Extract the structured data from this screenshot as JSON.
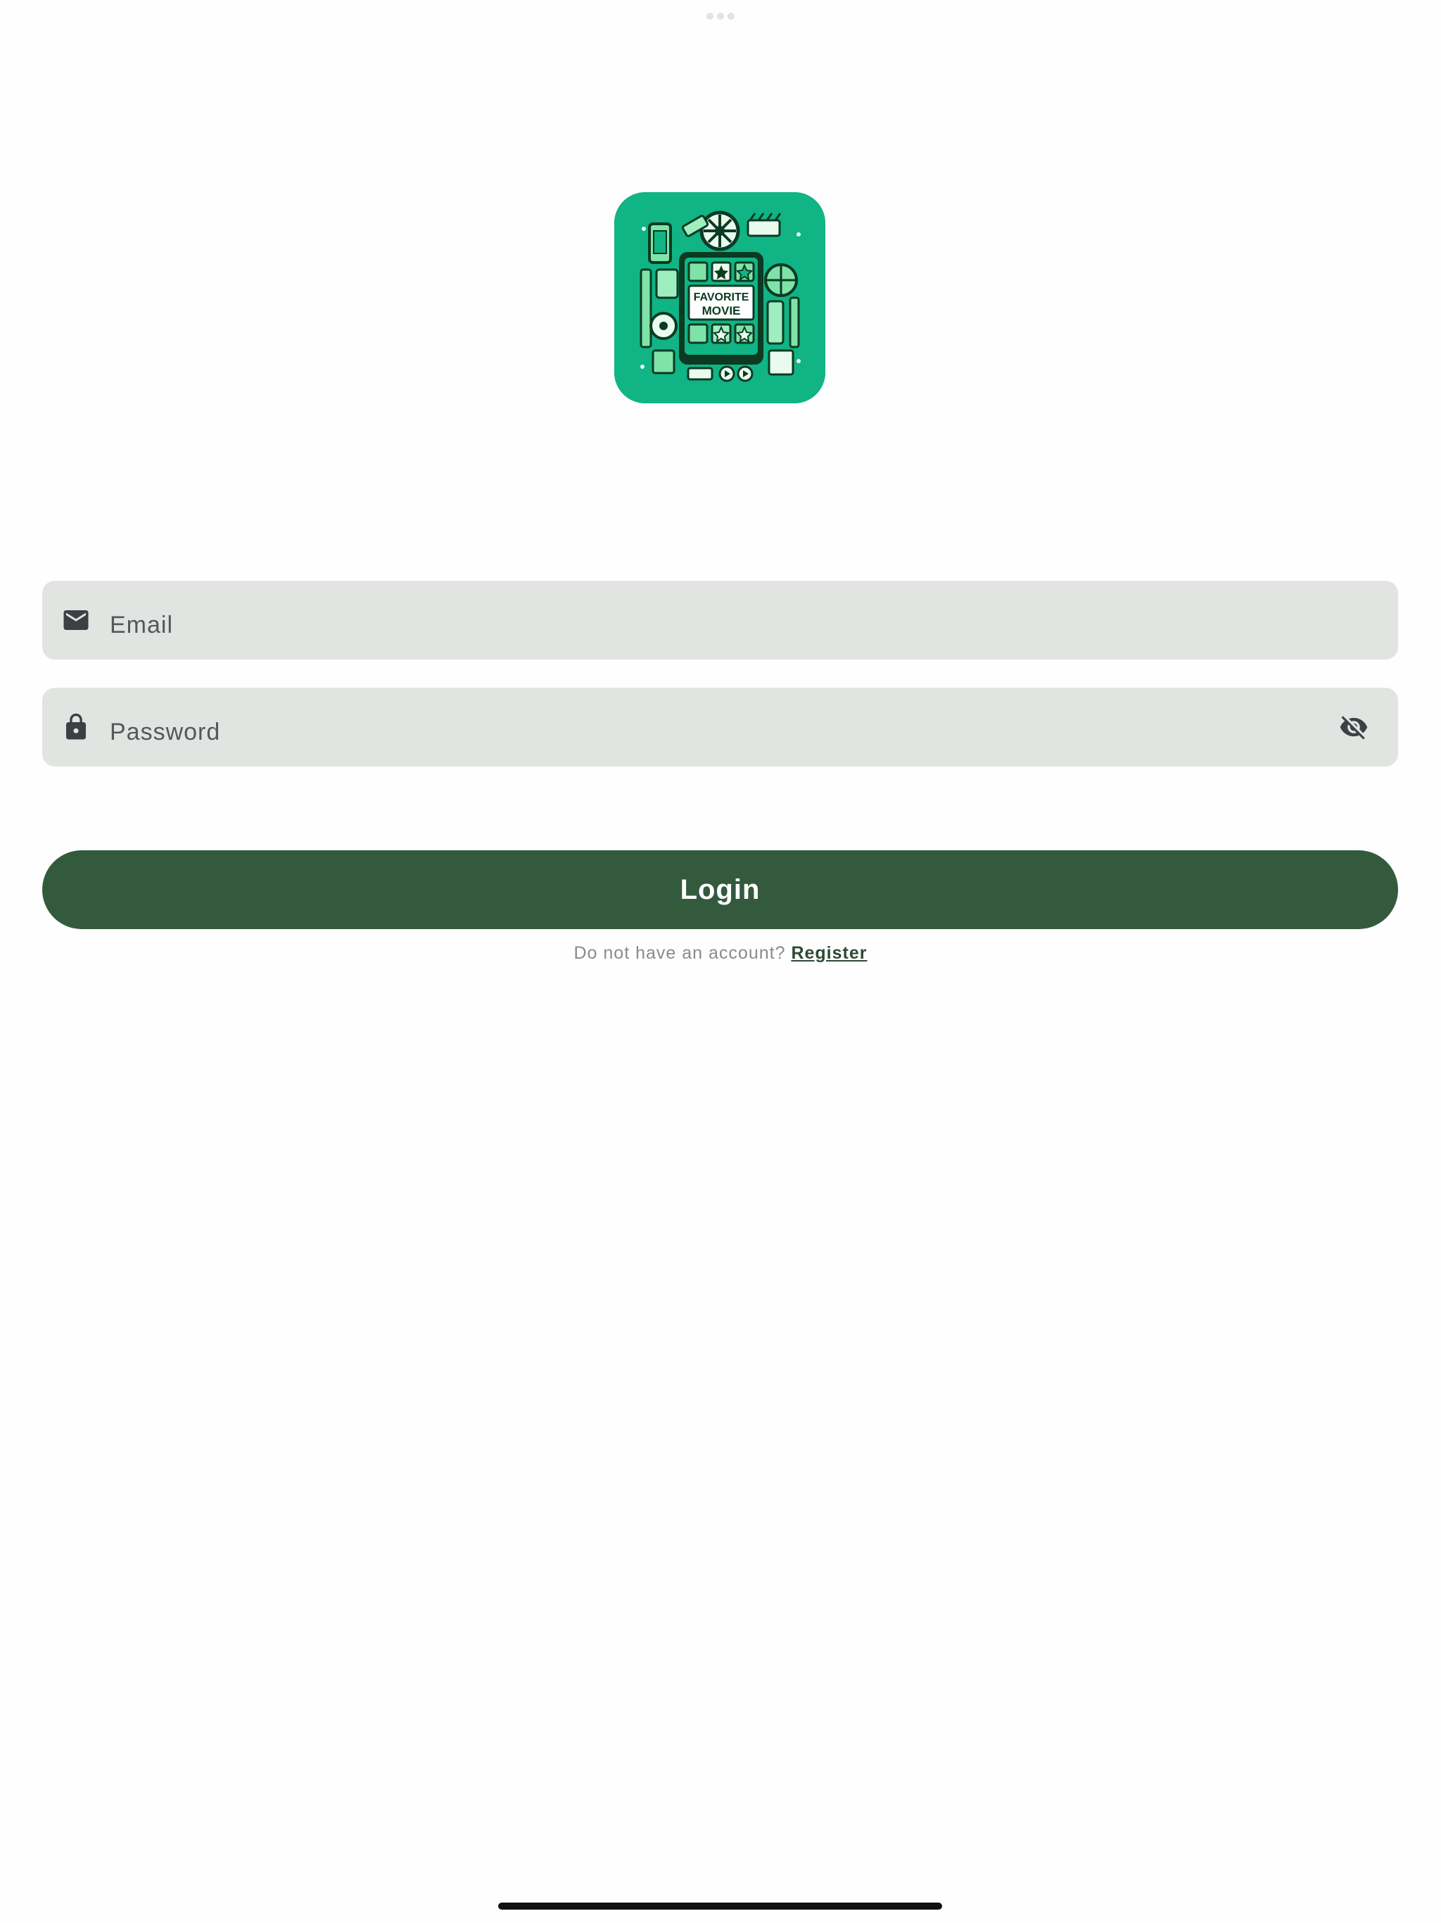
{
  "logo": {
    "title_line1": "FAVORITE",
    "title_line2": "MOVIE",
    "background_color": "#10b485",
    "icon": "favorite-movie-app-logo"
  },
  "form": {
    "email_placeholder": "Email",
    "email_value": "",
    "email_icon": "mail-icon",
    "password_placeholder": "Password",
    "password_value": "",
    "password_icon": "lock-icon",
    "password_toggle_icon": "eye-off-icon",
    "login_label": "Login"
  },
  "footer": {
    "no_account_text": "Do not have an account?",
    "register_label": "Register"
  },
  "colors": {
    "field_background": "#e1e4e1",
    "primary_button": "#345a3e",
    "link": "#2d4a35"
  }
}
